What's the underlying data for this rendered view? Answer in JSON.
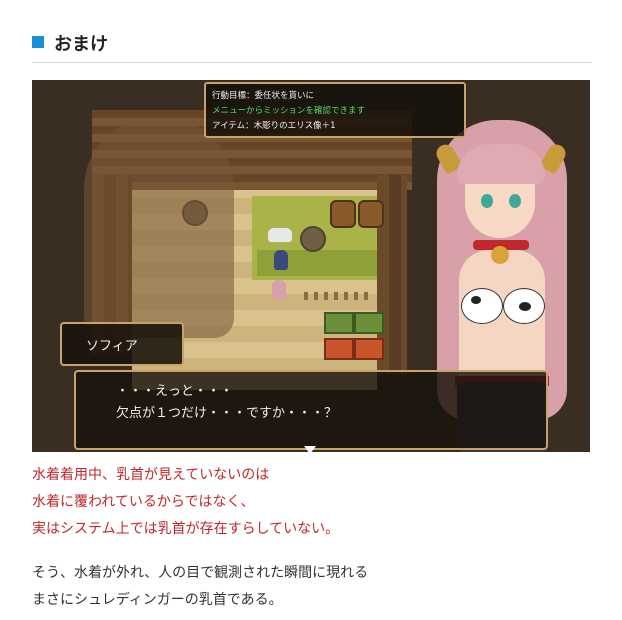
{
  "section": {
    "title": "おまけ",
    "marker_color": "#1a8fd6"
  },
  "game": {
    "mission_panel": {
      "line1": "行動目標：委任状を貰いに",
      "line2": "メニューからミッションを確認できます",
      "line3": "アイテム：木彫りのエリス像＋1"
    },
    "speaker_name": "ソフィア",
    "message": {
      "line1": "・・・えっと・・・",
      "line2": "欠点が１つだけ・・・ですか・・・？"
    }
  },
  "paragraph_red": [
    "水着着用中、乳首が見えていないのは",
    "水着に覆われているからではなく、",
    "実はシステム上では乳首が存在すらしていない。"
  ],
  "paragraph_black": [
    "そう、水着が外れ、人の目で観測された瞬間に現れる",
    "まさにシュレディンガーの乳首である。"
  ]
}
